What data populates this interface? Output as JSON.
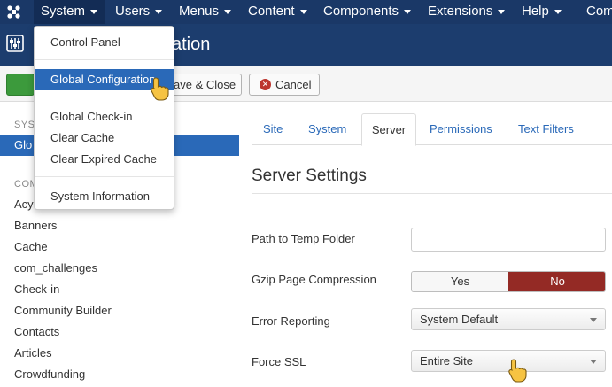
{
  "nav": {
    "items": [
      "System",
      "Users",
      "Menus",
      "Content",
      "Components",
      "Extensions",
      "Help",
      "Com"
    ]
  },
  "header": {
    "title_fragment": "ation"
  },
  "toolbar": {
    "save_close_label": "ave & Close",
    "cancel_label": "Cancel"
  },
  "sidebar": {
    "section1_heading": "SYS",
    "active_item": "Glo",
    "section2_heading": "COM",
    "items": [
      "Acy",
      "Banners",
      "Cache",
      "com_challenges",
      "Check-in",
      "Community Builder",
      "Contacts",
      "Articles",
      "Crowdfunding"
    ]
  },
  "dropdown": {
    "items": [
      "Control Panel",
      "Global Configuration",
      "Global Check-in",
      "Clear Cache",
      "Clear Expired Cache",
      "System Information"
    ]
  },
  "tabs": [
    "Site",
    "System",
    "Server",
    "Permissions",
    "Text Filters"
  ],
  "content": {
    "section_title": "Server Settings",
    "fields": {
      "temp_path_label": "Path to Temp Folder",
      "temp_path_value": "",
      "gzip_label": "Gzip Page Compression",
      "gzip_yes": "Yes",
      "gzip_no": "No",
      "error_label": "Error Reporting",
      "error_value": "System Default",
      "ssl_label": "Force SSL",
      "ssl_value": "Entire Site"
    }
  },
  "colors": {
    "nav_bg": "#1a3867",
    "header_bg": "#1c3d6e",
    "accent_blue": "#2a69b8",
    "toggle_no": "#942a25",
    "save_green": "#3c9a3c"
  }
}
